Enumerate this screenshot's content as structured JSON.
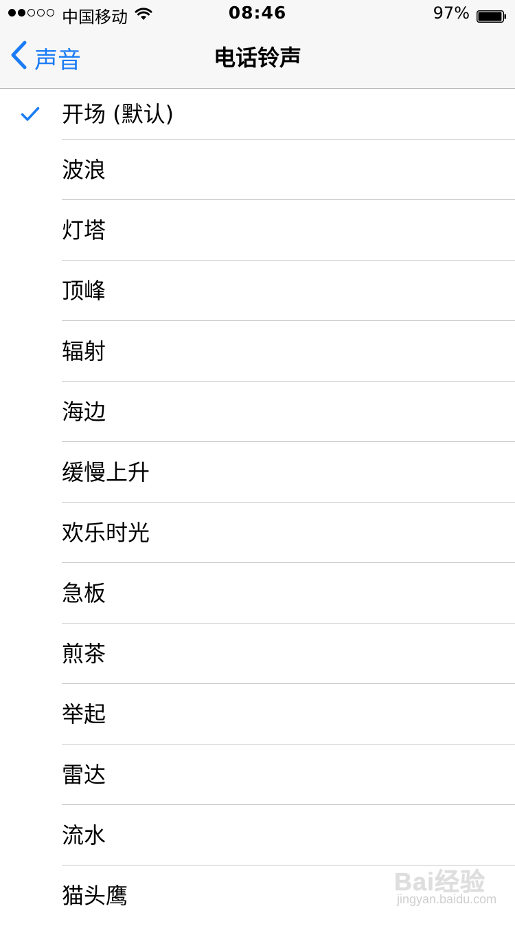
{
  "status_bar": {
    "carrier": "中国移动",
    "time": "08:46",
    "battery_percent": "97%",
    "battery_level": 0.97,
    "signal_bars_filled": 2,
    "signal_bars_total": 5,
    "wifi_icon": "wifi-icon"
  },
  "nav": {
    "back_label": "声音",
    "title": "电话铃声"
  },
  "ringtones": [
    {
      "label": "开场 (默认)",
      "selected": true
    },
    {
      "label": "波浪",
      "selected": false
    },
    {
      "label": "灯塔",
      "selected": false
    },
    {
      "label": "顶峰",
      "selected": false
    },
    {
      "label": "辐射",
      "selected": false
    },
    {
      "label": "海边",
      "selected": false
    },
    {
      "label": "缓慢上升",
      "selected": false
    },
    {
      "label": "欢乐时光",
      "selected": false
    },
    {
      "label": "急板",
      "selected": false
    },
    {
      "label": "煎茶",
      "selected": false
    },
    {
      "label": "举起",
      "selected": false
    },
    {
      "label": "雷达",
      "selected": false
    },
    {
      "label": "流水",
      "selected": false
    },
    {
      "label": "猫头鹰",
      "selected": false
    }
  ],
  "watermark": {
    "main": "Bai经验",
    "sub": "jingyan.baidu.com"
  },
  "colors": {
    "accent": "#1a7cf5",
    "separator": "#c8c7cc",
    "bar_background": "#f7f7f7"
  }
}
